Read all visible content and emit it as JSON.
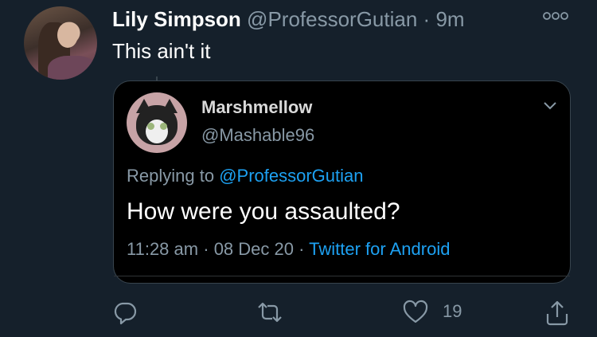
{
  "tweet": {
    "author_name": "Lily Simpson",
    "author_handle": "@ProfessorGutian",
    "separator": "·",
    "time": "9m",
    "text": "This ain't it"
  },
  "quoted": {
    "author_name": "Marshmellow",
    "author_handle": "@Mashable96",
    "replying_prefix": "Replying to",
    "replying_to": "@ProfessorGutian",
    "text": "How were you assaulted?",
    "time": "11:28 am",
    "sep1": "·",
    "date": "08 Dec 20",
    "sep2": "·",
    "source": "Twitter for Android"
  },
  "actions": {
    "like_count": "19",
    "icons": [
      "reply-icon",
      "retweet-icon",
      "like-icon",
      "share-icon"
    ]
  },
  "colors": {
    "background": "#15202b",
    "card_background": "#000000",
    "muted": "#8899a6",
    "accent": "#1da1f2",
    "border": "#38444d"
  }
}
